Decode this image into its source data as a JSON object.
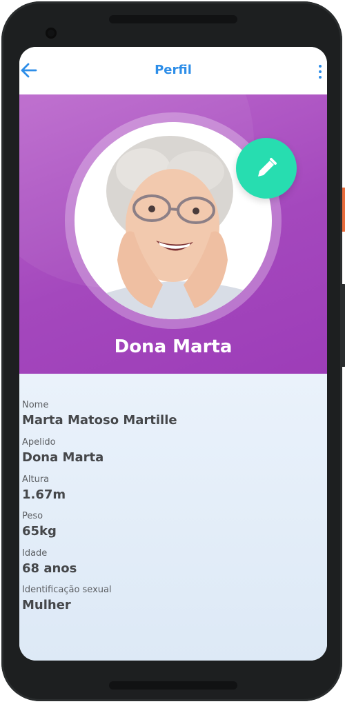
{
  "appbar": {
    "title": "Perfil",
    "back_icon": "arrow-left-icon",
    "menu_icon": "more-vertical-icon"
  },
  "profile": {
    "display_name": "Dona Marta",
    "edit_icon": "pencil-icon"
  },
  "fields": [
    {
      "label": "Nome",
      "value": "Marta Matoso Martille"
    },
    {
      "label": "Apelido",
      "value": "Dona Marta"
    },
    {
      "label": "Altura",
      "value": "1.67m"
    },
    {
      "label": "Peso",
      "value": "65kg"
    },
    {
      "label": "Idade",
      "value": "68 anos"
    },
    {
      "label": "Identificação sexual",
      "value": "Mulher"
    }
  ],
  "colors": {
    "accent_blue": "#2e8ee8",
    "header_purple": "#a448bd",
    "fab_green": "#27ddb0",
    "info_bg": "#e5eef9"
  }
}
